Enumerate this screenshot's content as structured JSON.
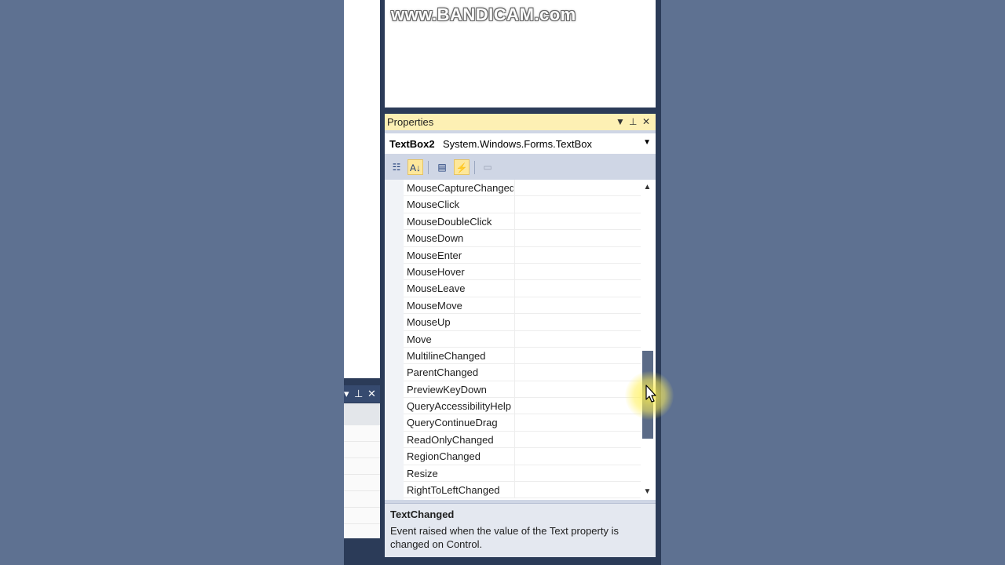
{
  "watermark": "www.BANDICAM.com",
  "properties": {
    "title": "Properties",
    "object_name": "TextBox2",
    "object_type": "System.Windows.Forms.TextBox",
    "events": [
      "MouseCaptureChanged",
      "MouseClick",
      "MouseDoubleClick",
      "MouseDown",
      "MouseEnter",
      "MouseHover",
      "MouseLeave",
      "MouseMove",
      "MouseUp",
      "Move",
      "MultilineChanged",
      "ParentChanged",
      "PreviewKeyDown",
      "QueryAccessibilityHelp",
      "QueryContinueDrag",
      "ReadOnlyChanged",
      "RegionChanged",
      "Resize",
      "RightToLeftChanged"
    ],
    "description_title": "TextChanged",
    "description_text": "Event raised when the value of the Text property is changed on Control."
  },
  "icons": {
    "dropdown": "chevron-down-icon",
    "pin": "pin-icon",
    "close": "close-icon",
    "categorized": "categorized-icon",
    "alphabetical": "sort-alphabetical-icon",
    "properties": "properties-icon",
    "events": "events-lightning-icon",
    "property_pages": "property-pages-icon"
  },
  "colors": {
    "title_bar": "#fdf0b4",
    "background": "#5e7191",
    "scroll_thumb": "#5b6b87",
    "active_tool": "#fde79a"
  }
}
